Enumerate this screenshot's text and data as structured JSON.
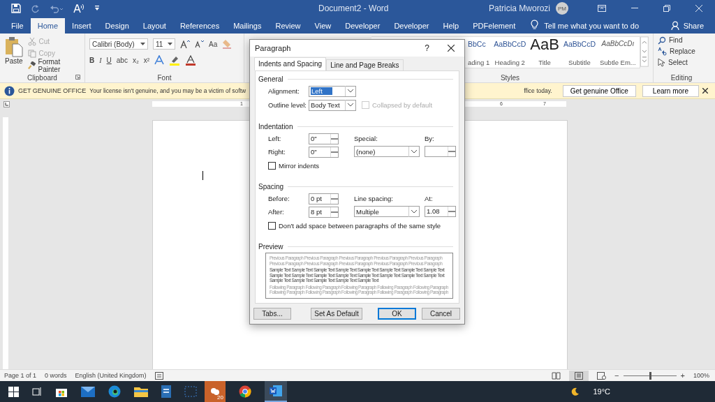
{
  "window": {
    "title": "Document2  -  Word",
    "user": "Patricia Mworozi",
    "avatar": "PM"
  },
  "ribbon_tabs": [
    {
      "label": "File",
      "selected": false
    },
    {
      "label": "Home",
      "selected": true
    },
    {
      "label": "Insert",
      "selected": false
    },
    {
      "label": "Design",
      "selected": false
    },
    {
      "label": "Layout",
      "selected": false
    },
    {
      "label": "References",
      "selected": false
    },
    {
      "label": "Mailings",
      "selected": false
    },
    {
      "label": "Review",
      "selected": false
    },
    {
      "label": "View",
      "selected": false
    },
    {
      "label": "Developer",
      "selected": false
    },
    {
      "label": "Developer",
      "selected": false
    },
    {
      "label": "Help",
      "selected": false
    },
    {
      "label": "PDFelement",
      "selected": false
    }
  ],
  "tell_me": {
    "placeholder": "Tell me what you want to do"
  },
  "share": "Share",
  "clipboard": {
    "paste": "Paste",
    "cut": "Cut",
    "copy": "Copy",
    "format_painter": "Format Painter",
    "group": "Clipboard"
  },
  "font": {
    "name": "Calibri (Body)",
    "size": "11",
    "change_case": "Aa",
    "format_buttons": [
      "B",
      "I",
      "U",
      "abc",
      "x₂",
      "x²"
    ],
    "group": "Font"
  },
  "styles": {
    "items": [
      {
        "sample": "BbCc",
        "name": "ading 1"
      },
      {
        "sample": "AaBbCcD",
        "name": "Heading 2"
      },
      {
        "sample": "AaB",
        "name": "Title",
        "kind": "large"
      },
      {
        "sample": "AaBbCcD",
        "name": "Subtitle"
      },
      {
        "sample": "AaBbCcDı",
        "name": "Subtle Em...",
        "kind": "italic"
      }
    ],
    "group": "Styles"
  },
  "editing": {
    "find": "Find",
    "replace": "Replace",
    "select": "Select",
    "group": "Editing"
  },
  "infobar": {
    "title": "GET GENUINE OFFICE",
    "message_start": "Your license isn't genuine, and you may be a victim of softw",
    "message_end": "ffice today.",
    "buttons": [
      "Get genuine Office",
      "Learn more"
    ]
  },
  "ruler": {
    "left_numbers": [
      "1"
    ],
    "right_numbers": [
      "6",
      "7"
    ]
  },
  "dialog": {
    "title": "Paragraph",
    "help": "?",
    "tabs": [
      {
        "label": "Indents and Spacing",
        "selected": true
      },
      {
        "label": "Line and Page Breaks",
        "selected": false
      }
    ],
    "general": {
      "heading": "General",
      "alignment_label": "Alignment:",
      "alignment": "Left",
      "outline_label": "Outline level:",
      "outline": "Body Text",
      "collapsed": {
        "label": "Collapsed by default",
        "checked": false,
        "disabled": true
      }
    },
    "indentation": {
      "heading": "Indentation",
      "left_label": "Left:",
      "left": "0\"",
      "right_label": "Right:",
      "right": "0\"",
      "special_label": "Special:",
      "special": "(none)",
      "by_label": "By:",
      "mirror": {
        "label": "Mirror indents",
        "checked": false,
        "disabled": false
      }
    },
    "spacing": {
      "heading": "Spacing",
      "before_label": "Before:",
      "before": "0 pt",
      "after_label": "After:",
      "after": "8 pt",
      "line_label": "Line spacing:",
      "line": "Multiple",
      "at_label": "At:",
      "at": "1.08",
      "dont_add": {
        "label": "Don't add space between paragraphs of the same style",
        "checked": false,
        "disabled": false
      }
    },
    "preview": {
      "heading": "Preview",
      "previous": [
        "Previous Paragraph Previous Paragraph Previous Paragraph Previous Paragraph Previous Paragraph",
        "Previous Paragraph Previous Paragraph Previous Paragraph Previous Paragraph Previous Paragraph"
      ],
      "sample": [
        "Sample Text Sample Text Sample Text Sample Text Sample Text Sample Text Sample Text Sample Text",
        "Sample Text Sample Text Sample Text Sample Text Sample Text Sample Text Sample Text Sample Text",
        "Sample Text Sample Text Sample Text Sample Text Sample Text"
      ],
      "following": [
        "Following Paragraph Following Paragraph Following Paragraph Following Paragraph Following Paragraph",
        "Following Paragraph Following Paragraph Following Paragraph Following Paragraph Following Paragraph"
      ]
    },
    "buttons": [
      {
        "label": "Tabs...",
        "default": false
      },
      {
        "label": "Set As Default",
        "default": false
      },
      {
        "label": "OK",
        "default": true
      },
      {
        "label": "Cancel",
        "default": false
      }
    ]
  },
  "status_bar": {
    "page": "Page 1 of 1",
    "words": "0 words",
    "language": "English (United Kingdom)",
    "zoom": {
      "level": 0.5
    },
    "zoom_out": "−",
    "zoom_in": "+",
    "zoom_label": "100%"
  },
  "taskbar": {
    "badge": "20",
    "temperature": "19°C"
  }
}
